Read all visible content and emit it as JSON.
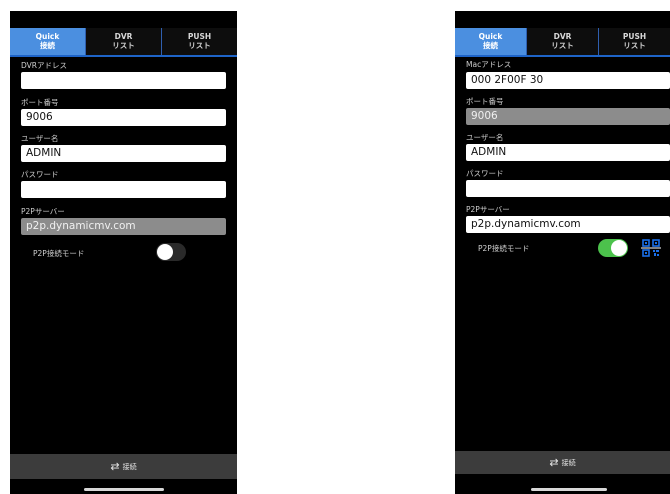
{
  "left": {
    "tabs": [
      {
        "line1": "Quick",
        "line2": "接続",
        "active": true
      },
      {
        "line1": "DVR",
        "line2": "リスト",
        "active": false
      },
      {
        "line1": "PUSH",
        "line2": "リスト",
        "active": false
      }
    ],
    "fields": {
      "address_label": "DVRアドレス",
      "address_value": "",
      "port_label": "ポート番号",
      "port_value": "9006",
      "user_label": "ユーザー名",
      "user_value": "ADMIN",
      "password_label": "パスワード",
      "password_value": "",
      "p2p_server_label": "P2Pサーバー",
      "p2p_server_value": "p2p.dynamicmv.com"
    },
    "p2p_mode": {
      "label": "P2P接続モード",
      "state": "off"
    },
    "connect_button": {
      "icon": "⇄",
      "label": "接続"
    }
  },
  "right": {
    "tabs": [
      {
        "line1": "Quick",
        "line2": "接続",
        "active": true
      },
      {
        "line1": "DVR",
        "line2": "リスト",
        "active": false
      },
      {
        "line1": "PUSH",
        "line2": "リスト",
        "active": false
      }
    ],
    "fields": {
      "address_label": "Macアドレス",
      "address_value": "000  2F00F  30",
      "port_label": "ポート番号",
      "port_value": "9006",
      "user_label": "ユーザー名",
      "user_value": "ADMIN",
      "password_label": "パスワード",
      "password_value": "",
      "p2p_server_label": "P2Pサーバー",
      "p2p_server_value": "p2p.dynamicmv.com"
    },
    "p2p_mode": {
      "label": "P2P接続モード",
      "state": "on"
    },
    "qr_icon": "qr-scan-icon",
    "connect_button": {
      "icon": "⇄",
      "label": "接続"
    }
  },
  "colors": {
    "tab_active": "#4b8fe0",
    "tab_border": "#1e64c8",
    "toggle_on": "#4cc24c",
    "qr": "#1a6ee8"
  }
}
